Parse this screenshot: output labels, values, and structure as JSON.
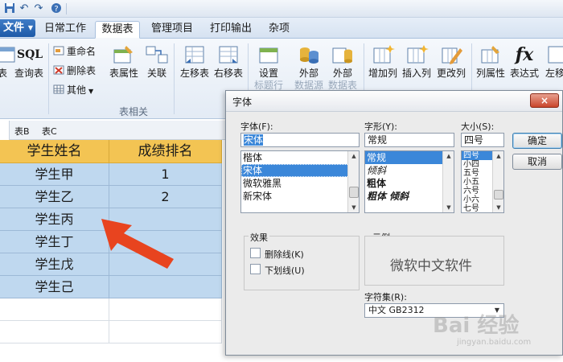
{
  "menu": {
    "file_label": "文件",
    "tabs": [
      "日常工作",
      "数据表",
      "管理项目",
      "打印输出",
      "杂项"
    ]
  },
  "ribbon": {
    "sql_text": "SQL",
    "buttons": {
      "table": "表",
      "query_table": "查询表",
      "table_properties": "表属性",
      "relation": "关联",
      "move_left": "左移表",
      "move_right": "右移表",
      "setup": "设置",
      "setup_sub": "标题行",
      "external1": "外部",
      "external1_sub": "数据源",
      "external2": "外部",
      "external2_sub": "数据表",
      "add_column": "增加列",
      "insert_column": "插入列",
      "change_column": "更改列",
      "column_properties": "列属性",
      "expression": "表达式",
      "left_partial": "左移"
    },
    "small_buttons": {
      "rename": "重命名",
      "delete_table": "删除表",
      "other": "其他"
    },
    "group_label": "表相关",
    "fx_symbol": "fx"
  },
  "sheet_tabs": [
    "表B",
    "表C"
  ],
  "grid": {
    "headers": [
      "学生姓名",
      "成绩排名"
    ],
    "rows": [
      {
        "name": "学生甲",
        "rank": "1"
      },
      {
        "name": "学生乙",
        "rank": "2"
      },
      {
        "name": "学生丙",
        "rank": ""
      },
      {
        "name": "学生丁",
        "rank": ""
      },
      {
        "name": "学生戊",
        "rank": ""
      },
      {
        "name": "学生己",
        "rank": ""
      }
    ]
  },
  "dialog": {
    "title": "字体",
    "font_label": "字体(F):",
    "font_value": "宋体",
    "font_list": [
      "楷体",
      "宋体",
      "微软雅黑",
      "新宋体"
    ],
    "font_selected": "宋体",
    "style_label": "字形(Y):",
    "style_value": "常规",
    "style_list": [
      "常规",
      "倾斜",
      "粗体",
      "粗体 倾斜"
    ],
    "style_selected": "常规",
    "size_label": "大小(S):",
    "size_value": "四号",
    "size_list": [
      "四号",
      "小四",
      "五号",
      "小五",
      "六号",
      "小六",
      "七号"
    ],
    "size_selected": "四号",
    "ok_label": "确定",
    "cancel_label": "取消",
    "effects_label": "效果",
    "strikethrough_label": "删除线(K)",
    "underline_label": "下划线(U)",
    "sample_label": "示例",
    "sample_text": "微软中文软件",
    "charset_label": "字符集(R):",
    "charset_value": "中文 GB2312",
    "close_symbol": "×"
  },
  "watermark": {
    "text": "Bai 经验",
    "sub": "jingyan.baidu.com"
  },
  "colors": {
    "header_fill": "#f3c453",
    "cell_fill": "#bfd8ef",
    "arrow": "#e8441f",
    "selection": "#3b87d9"
  }
}
